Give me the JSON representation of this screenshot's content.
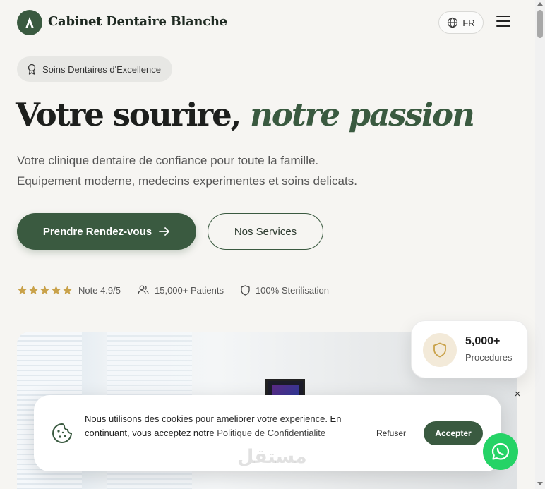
{
  "header": {
    "brand": "Cabinet Dentaire Blanche",
    "language": "FR"
  },
  "hero": {
    "badge": "Soins Dentaires d'Excellence",
    "title_main": "Votre sourire, ",
    "title_accent": "notre passion",
    "lead_line1": "Votre clinique dentaire de confiance pour toute la famille.",
    "lead_line2": "Equipement moderne, medecins experimentes et soins delicats.",
    "primary_cta": "Prendre Rendez-vous",
    "secondary_cta": "Nos Services"
  },
  "stats": {
    "rating_stars": 5,
    "rating": "Note 4.9/5",
    "patients": "15,000+ Patients",
    "sterilisation": "100% Sterilisation"
  },
  "floating_card": {
    "value": "5,000+",
    "label": "Procedures"
  },
  "cookie_banner": {
    "text": "Nous utilisons des cookies pour ameliorer votre experience. En continuant, vous acceptez notre ",
    "link": "Politique de Confidentialite",
    "refuse": "Refuser",
    "accept": "Accepter",
    "close": "×"
  },
  "watermark": "مستقل",
  "colors": {
    "primary": "#3a5a40",
    "star": "#c9a24a",
    "background": "#f6f5f2",
    "whatsapp": "#25d366"
  }
}
